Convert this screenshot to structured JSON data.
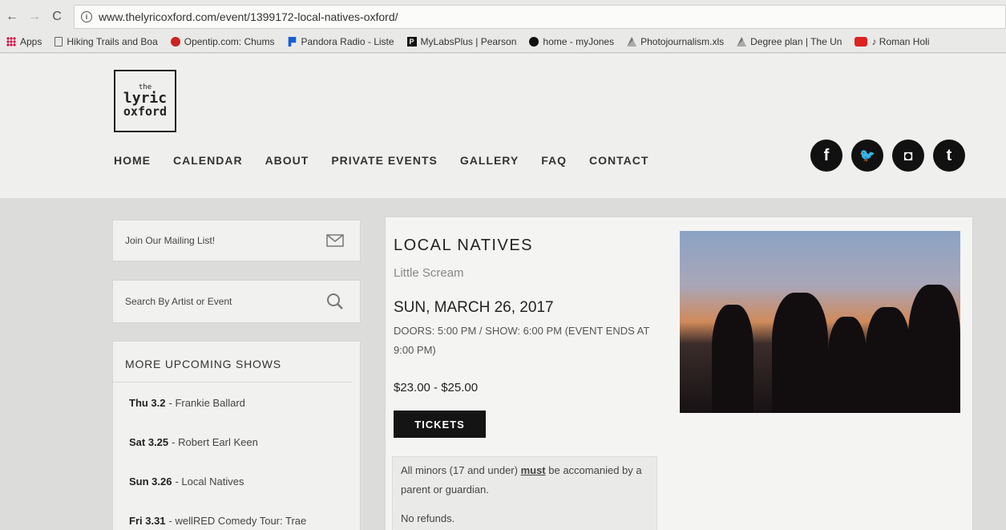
{
  "browser": {
    "url": "www.thelyricoxford.com/event/1399172-local-natives-oxford/",
    "bookmarks": [
      {
        "label": "Apps",
        "icon": "apps-icon"
      },
      {
        "label": "Hiking Trails and Boa",
        "icon": "page-icon"
      },
      {
        "label": "Opentip.com: Chums",
        "icon": "opentip-icon"
      },
      {
        "label": "Pandora Radio - Liste",
        "icon": "pandora-icon"
      },
      {
        "label": "MyLabsPlus | Pearson",
        "icon": "pearson-icon"
      },
      {
        "label": "home - myJones",
        "icon": "myjones-icon"
      },
      {
        "label": "Photojournalism.xls",
        "icon": "drive-icon"
      },
      {
        "label": "Degree plan | The Un",
        "icon": "drive-icon"
      },
      {
        "label": "♪ Roman Holi",
        "icon": "youtube-icon"
      }
    ]
  },
  "site": {
    "logo": {
      "line1": "the",
      "line2": "lyric",
      "line3": "oxford"
    },
    "nav": [
      "HOME",
      "CALENDAR",
      "ABOUT",
      "PRIVATE EVENTS",
      "GALLERY",
      "FAQ",
      "CONTACT"
    ],
    "social": [
      {
        "name": "facebook-icon",
        "glyph": "f"
      },
      {
        "name": "twitter-icon",
        "glyph": "🐦"
      },
      {
        "name": "instagram-icon",
        "glyph": "◘"
      },
      {
        "name": "tumblr-icon",
        "glyph": "t"
      }
    ]
  },
  "sidebar": {
    "mailing_label": "Join Our Mailing List!",
    "search_placeholder": "Search By Artist or Event",
    "upcoming_title": "MORE UPCOMING SHOWS",
    "shows": [
      {
        "date": "Thu 3.2",
        "name": "- Frankie Ballard"
      },
      {
        "date": "Sat 3.25",
        "name": "- Robert Earl Keen"
      },
      {
        "date": "Sun 3.26",
        "name": "- Local Natives"
      },
      {
        "date": "Fri 3.31",
        "name": "- wellRED Comedy Tour: Trae"
      }
    ]
  },
  "event": {
    "title": "LOCAL NATIVES",
    "support": "Little Scream",
    "date": "SUN, MARCH 26, 2017",
    "times": "DOORS: 5:00 PM / SHOW: 6:00 PM (EVENT ENDS AT 9:00 PM)",
    "price": "$23.00 - $25.00",
    "tickets_label": "TICKETS",
    "notice_pre": "All minors (17 and under) ",
    "notice_must": "must",
    "notice_post": " be accomanied by a parent or guardian.",
    "notice_refunds": "No refunds."
  }
}
